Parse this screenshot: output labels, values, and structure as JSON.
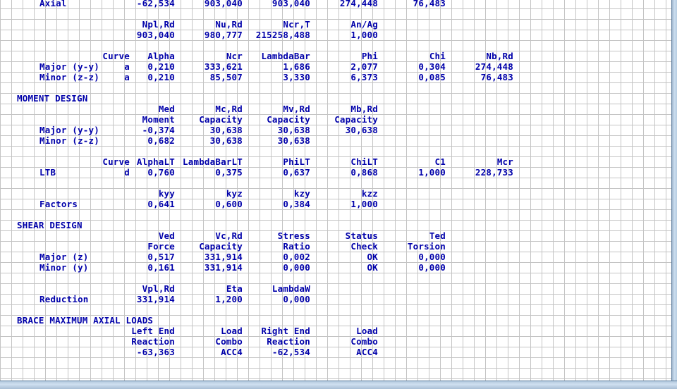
{
  "report": {
    "axial": {
      "label": "Axial",
      "values": [
        "-62,534",
        "903,040",
        "903,040",
        "274,448",
        "76,483"
      ]
    },
    "resistance": {
      "headers": [
        "Npl,Rd",
        "Nu,Rd",
        "Ncr,T",
        "An/Ag"
      ],
      "values": [
        "903,040",
        "980,777",
        "215258,488",
        "1,000"
      ]
    },
    "buckling": {
      "headers": [
        "Curve",
        "Alpha",
        "Ncr",
        "LambdaBar",
        "Phi",
        "Chi",
        "Nb,Rd"
      ],
      "rows": [
        {
          "label": "Major (y-y)",
          "cells": [
            "a",
            "0,210",
            "333,621",
            "1,686",
            "2,077",
            "0,304",
            "274,448"
          ]
        },
        {
          "label": "Minor (z-z)",
          "cells": [
            "a",
            "0,210",
            "85,507",
            "3,330",
            "6,373",
            "0,085",
            "76,483"
          ]
        }
      ]
    },
    "moment": {
      "title": "MOMENT DESIGN",
      "headers1": [
        "Med",
        "Mc,Rd",
        "Mv,Rd",
        "Mb,Rd"
      ],
      "headers2": [
        "Moment",
        "Capacity",
        "Capacity",
        "Capacity"
      ],
      "rows": [
        {
          "label": "Major (y-y)",
          "cells": [
            "-0,374",
            "30,638",
            "30,638",
            "30,638"
          ]
        },
        {
          "label": "Minor (z-z)",
          "cells": [
            "0,682",
            "30,638",
            "30,638",
            ""
          ]
        }
      ]
    },
    "ltb": {
      "headers": [
        "Curve",
        "AlphaLT",
        "LambdaBarLT",
        "PhiLT",
        "ChiLT",
        "C1",
        "Mcr"
      ],
      "label": "LTB",
      "cells": [
        "d",
        "0,760",
        "0,375",
        "0,637",
        "0,868",
        "1,000",
        "228,733"
      ]
    },
    "factors": {
      "headers": [
        "kyy",
        "kyz",
        "kzy",
        "kzz"
      ],
      "label": "Factors",
      "cells": [
        "0,641",
        "0,600",
        "0,384",
        "1,000"
      ]
    },
    "shear": {
      "title": "SHEAR DESIGN",
      "headers1": [
        "Ved",
        "Vc,Rd",
        "Stress",
        "Status",
        "Ted"
      ],
      "headers2": [
        "Force",
        "Capacity",
        "Ratio",
        "Check",
        "Torsion"
      ],
      "rows": [
        {
          "label": "Major (z)",
          "cells": [
            "0,517",
            "331,914",
            "0,002",
            "OK",
            "0,000"
          ]
        },
        {
          "label": "Minor (y)",
          "cells": [
            "0,161",
            "331,914",
            "0,000",
            "OK",
            "0,000"
          ]
        }
      ]
    },
    "reduction": {
      "headers": [
        "Vpl,Rd",
        "Eta",
        "LambdaW"
      ],
      "label": "Reduction",
      "cells": [
        "331,914",
        "1,200",
        "0,000"
      ]
    },
    "brace": {
      "title": "BRACE MAXIMUM AXIAL LOADS",
      "headers1": [
        "Left End",
        "Load",
        "Right End",
        "Load"
      ],
      "headers2": [
        "Reaction",
        "Combo",
        "Reaction",
        "Combo"
      ],
      "cells": [
        "-63,363",
        "ACC4",
        "-62,534",
        "ACC4"
      ]
    }
  }
}
